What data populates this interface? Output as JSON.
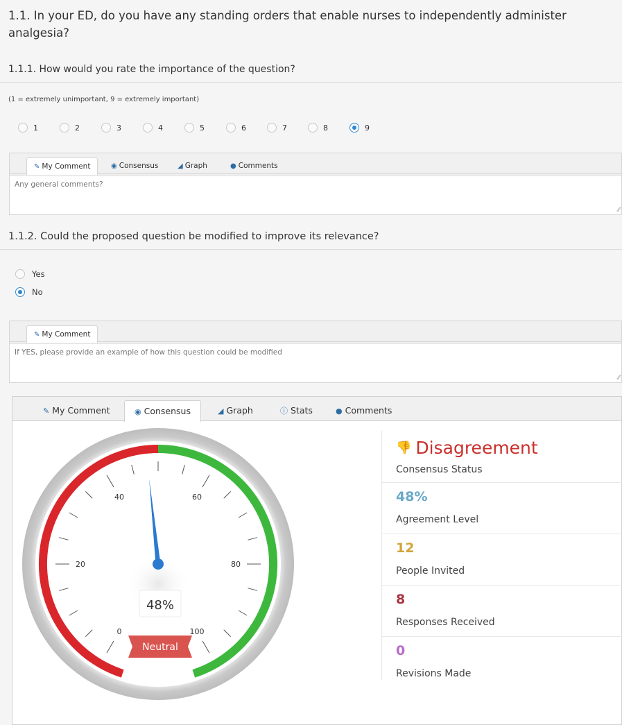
{
  "q1": {
    "title": "1.1. In your ED, do you have any standing orders that enable nurses to independently administer",
    "title_line2": "analgesia?"
  },
  "q111": {
    "title": "1.1.1. How would you rate the importance of the question?",
    "hint": "(1 = extremely unimportant, 9 = extremely important)",
    "options": [
      "1",
      "2",
      "3",
      "4",
      "5",
      "6",
      "7",
      "8",
      "9"
    ],
    "selected": "9"
  },
  "panel1": {
    "tabs": [
      {
        "label": "My Comment",
        "icon": "pencil-icon"
      },
      {
        "label": "Consensus",
        "icon": "dashboard-icon"
      },
      {
        "label": "Graph",
        "icon": "graph-icon"
      },
      {
        "label": "Comments",
        "icon": "speech-bubble-icon"
      }
    ],
    "placeholder": "Any general comments?"
  },
  "q112": {
    "title": "1.1.2. Could the proposed question be modified to improve its relevance?",
    "options": [
      "Yes",
      "No"
    ],
    "selected": "No"
  },
  "panel2": {
    "tabs": [
      {
        "label": "My Comment",
        "icon": "pencil-icon"
      }
    ],
    "placeholder": "If YES, please provide an example of how this question could be modified"
  },
  "panel3": {
    "tabs": [
      {
        "label": "My Comment",
        "icon": "pencil-icon"
      },
      {
        "label": "Consensus",
        "icon": "dashboard-icon"
      },
      {
        "label": "Graph",
        "icon": "graph-icon"
      },
      {
        "label": "Stats",
        "icon": "info-icon"
      },
      {
        "label": "Comments",
        "icon": "speech-bubble-icon"
      }
    ],
    "active_tab": "Consensus"
  },
  "gauge": {
    "value": 48,
    "value_label": "48%",
    "min": 0,
    "max": 100,
    "tick_labels": [
      "0",
      "20",
      "40",
      "60",
      "80",
      "100"
    ],
    "ribbon_label": "Neutral",
    "colors": {
      "red": "#d9262b",
      "green": "#3db83d",
      "needle": "#2a7ad0",
      "ribbon": "#d9534f"
    }
  },
  "consensus": {
    "status": "Disagreement",
    "status_caption": "Consensus Status",
    "status_icon": "thumbs-down-icon",
    "status_color": "#c9302c",
    "stats": [
      {
        "value": "48%",
        "caption": "Agreement Level",
        "color": "#6aa8c9"
      },
      {
        "value": "12",
        "caption": "People Invited",
        "color": "#d0a53a"
      },
      {
        "value": "8",
        "caption": "Responses Received",
        "color": "#a8333f"
      },
      {
        "value": "0",
        "caption": "Revisions Made",
        "color": "#b86ac7"
      }
    ]
  }
}
